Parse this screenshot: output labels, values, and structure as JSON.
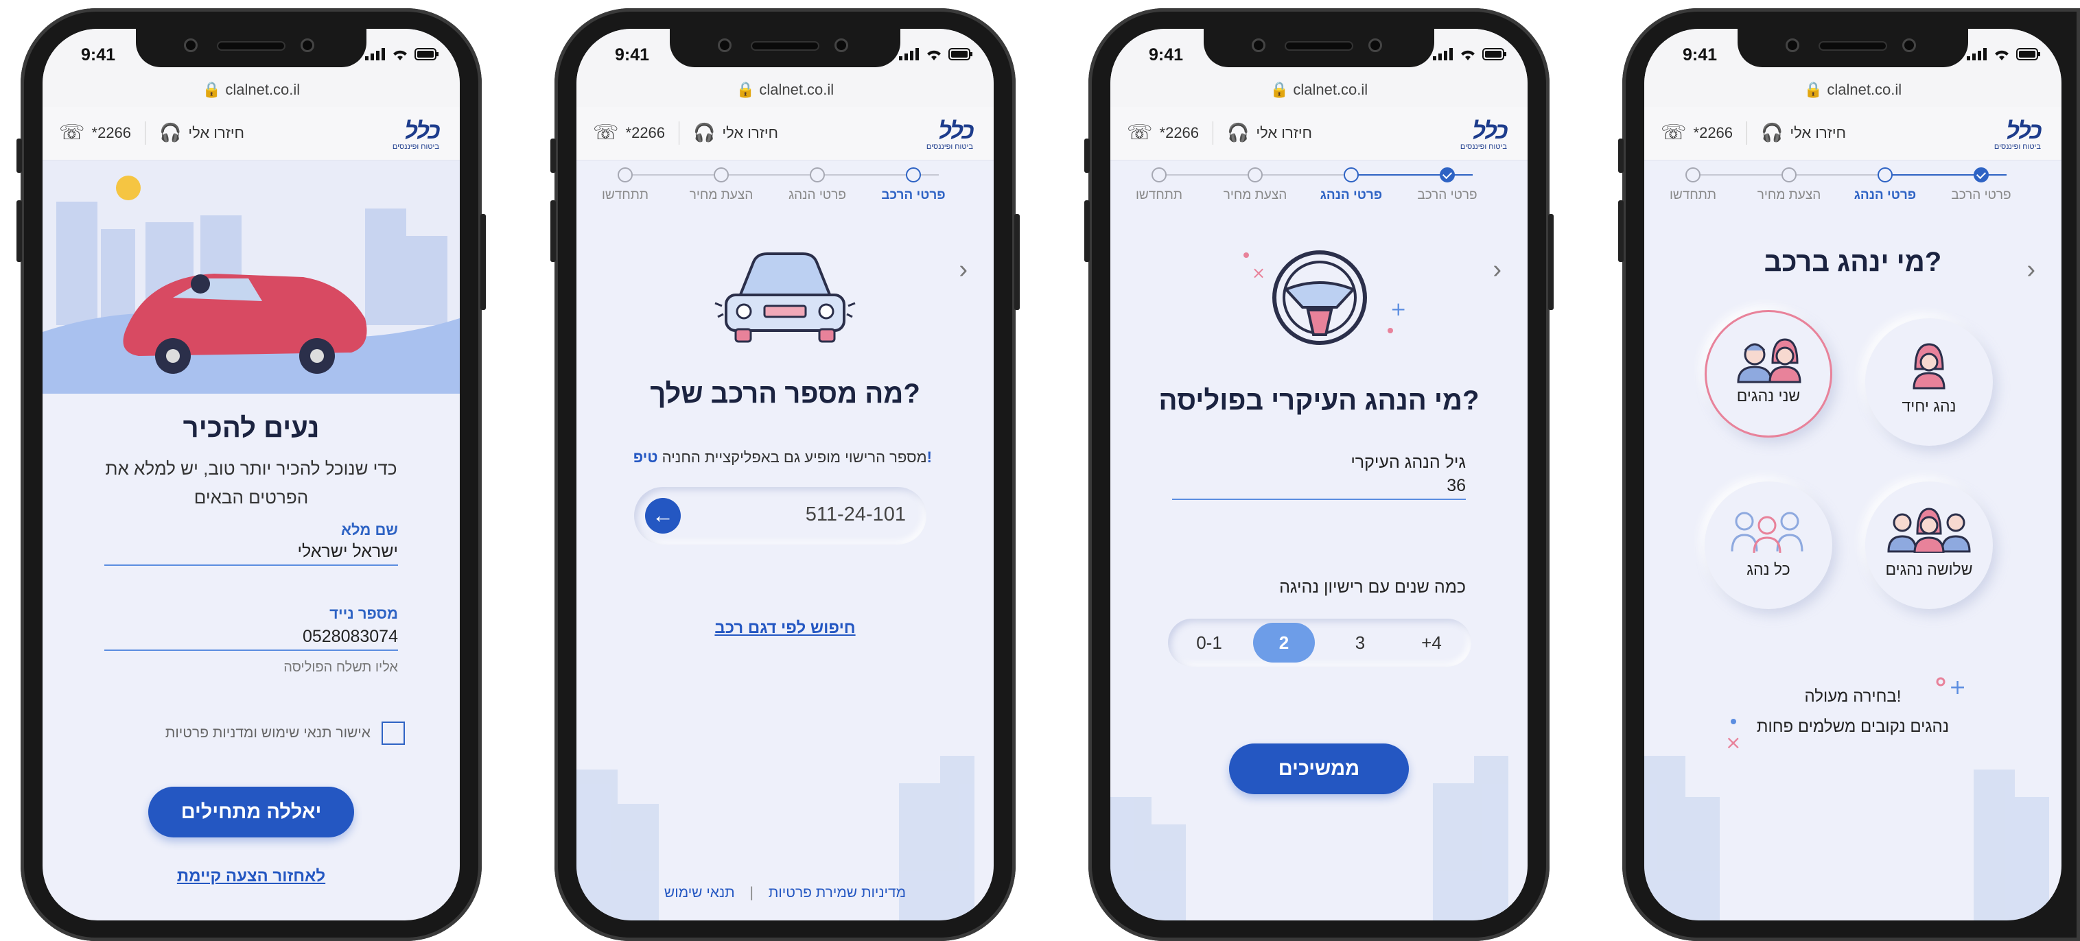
{
  "common": {
    "time": "9:41",
    "url": "clalnet.co.il",
    "phone_number": "*2266",
    "callback": "חיזרו אלי",
    "logo_main": "כלל",
    "logo_sub": "ביטוח ופיננסים"
  },
  "steps": [
    "פרטי הרכב",
    "פרטי הנהג",
    "הצעת מחיר",
    "תתחדשו"
  ],
  "screen1": {
    "title": "נעים להכיר",
    "subtitle_line1": "כדי שנוכל להכיר יותר טוב, יש למלא את",
    "subtitle_line2": "הפרטים הבאים",
    "name_label": "שם מלא",
    "name_value": "ישראל ישראלי",
    "mobile_label": "מספר נייד",
    "mobile_value": "0528083074",
    "mobile_hint": "אליו תשלח הפוליסה",
    "consent": "אישור תנאי שימוש ומדניות פרטיות",
    "cta": "יאללה מתחילים",
    "restore_link": "לאחזור הצעה קיימת"
  },
  "screen2": {
    "title": "מה מספר הרכב שלך?",
    "tip_label": "טיפ!",
    "tip_text": "מספר הרישוי מופיע גם באפליקציית החניה",
    "plate_value": "511-24-101",
    "search_link": "חיפוש לפי דגם רכב",
    "footer_terms": "תנאי שימוש",
    "footer_privacy": "מדיניות שמירת פרטיות"
  },
  "screen3": {
    "title": "מי הנהג העיקרי בפוליסה?",
    "age_label": "גיל הנהג העיקרי",
    "age_value": "36",
    "years_question": "כמה שנים עם רישיון נהיגה",
    "year_options": [
      "0-1",
      "2",
      "3",
      "+4"
    ],
    "selected_year": "2",
    "cta": "ממשיכים"
  },
  "screen4": {
    "title": "מי ינהג ברכב?",
    "options": [
      "נהג יחיד",
      "שני נהגים",
      "שלושה נהגים",
      "כל נהג"
    ],
    "selected": "שני נהגים",
    "note_line1": "בחירה מעולה!",
    "note_line2": "נהגים נקובים משלמים פחות"
  },
  "colors": {
    "primary": "#2457c2",
    "navy": "#1b2340",
    "accent_pink": "#e8829a",
    "background": "#eef0fa"
  }
}
